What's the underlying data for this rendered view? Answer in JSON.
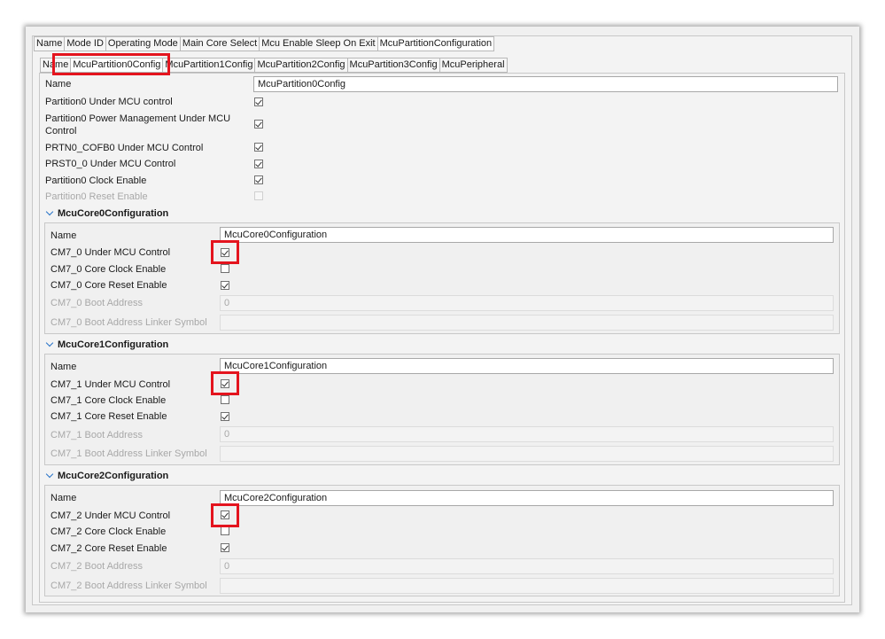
{
  "tabs_top": [
    "Name",
    "Mode ID",
    "Operating Mode",
    "Main Core Select",
    "Mcu Enable Sleep On Exit",
    "McuPartitionConfiguration"
  ],
  "tabs_sub": [
    "Name",
    "McuPartition0Config",
    "McuPartition1Config",
    "McuPartition2Config",
    "McuPartition3Config",
    "McuPeripheral"
  ],
  "partition": {
    "name_label": "Name",
    "name_value": "McuPartition0Config",
    "under_mcu": "Partition0 Under MCU control",
    "power_mgmt": "Partition0 Power Management Under MCU Control",
    "cofb": "PRTN0_COFB0 Under MCU Control",
    "prst": "PRST0_0 Under MCU Control",
    "clock": "Partition0 Clock Enable",
    "reset": "Partition0 Reset Enable"
  },
  "cores": [
    {
      "title": "McuCore0Configuration",
      "name_label": "Name",
      "name_value": "McuCore0Configuration",
      "under_mcu": "CM7_0 Under MCU Control",
      "clock": "CM7_0 Core Clock Enable",
      "reset": "CM7_0 Core Reset Enable",
      "boot_addr": "CM7_0 Boot Address",
      "boot_addr_value": "0",
      "boot_sym": "CM7_0 Boot Address Linker Symbol"
    },
    {
      "title": "McuCore1Configuration",
      "name_label": "Name",
      "name_value": "McuCore1Configuration",
      "under_mcu": "CM7_1 Under MCU Control",
      "clock": "CM7_1 Core Clock Enable",
      "reset": "CM7_1 Core Reset Enable",
      "boot_addr": "CM7_1 Boot Address",
      "boot_addr_value": "0",
      "boot_sym": "CM7_1 Boot Address Linker Symbol"
    },
    {
      "title": "McuCore2Configuration",
      "name_label": "Name",
      "name_value": "McuCore2Configuration",
      "under_mcu": "CM7_2 Under MCU Control",
      "clock": "CM7_2 Core Clock Enable",
      "reset": "CM7_2 Core Reset Enable",
      "boot_addr": "CM7_2 Boot Address",
      "boot_addr_value": "0",
      "boot_sym": "CM7_2 Boot Address Linker Symbol"
    }
  ],
  "colors": {
    "highlight": "#e4141e",
    "chevron": "#2a74c8"
  },
  "icons": {
    "checkbox": "checkmark-icon",
    "section": "chevron-down-icon"
  }
}
